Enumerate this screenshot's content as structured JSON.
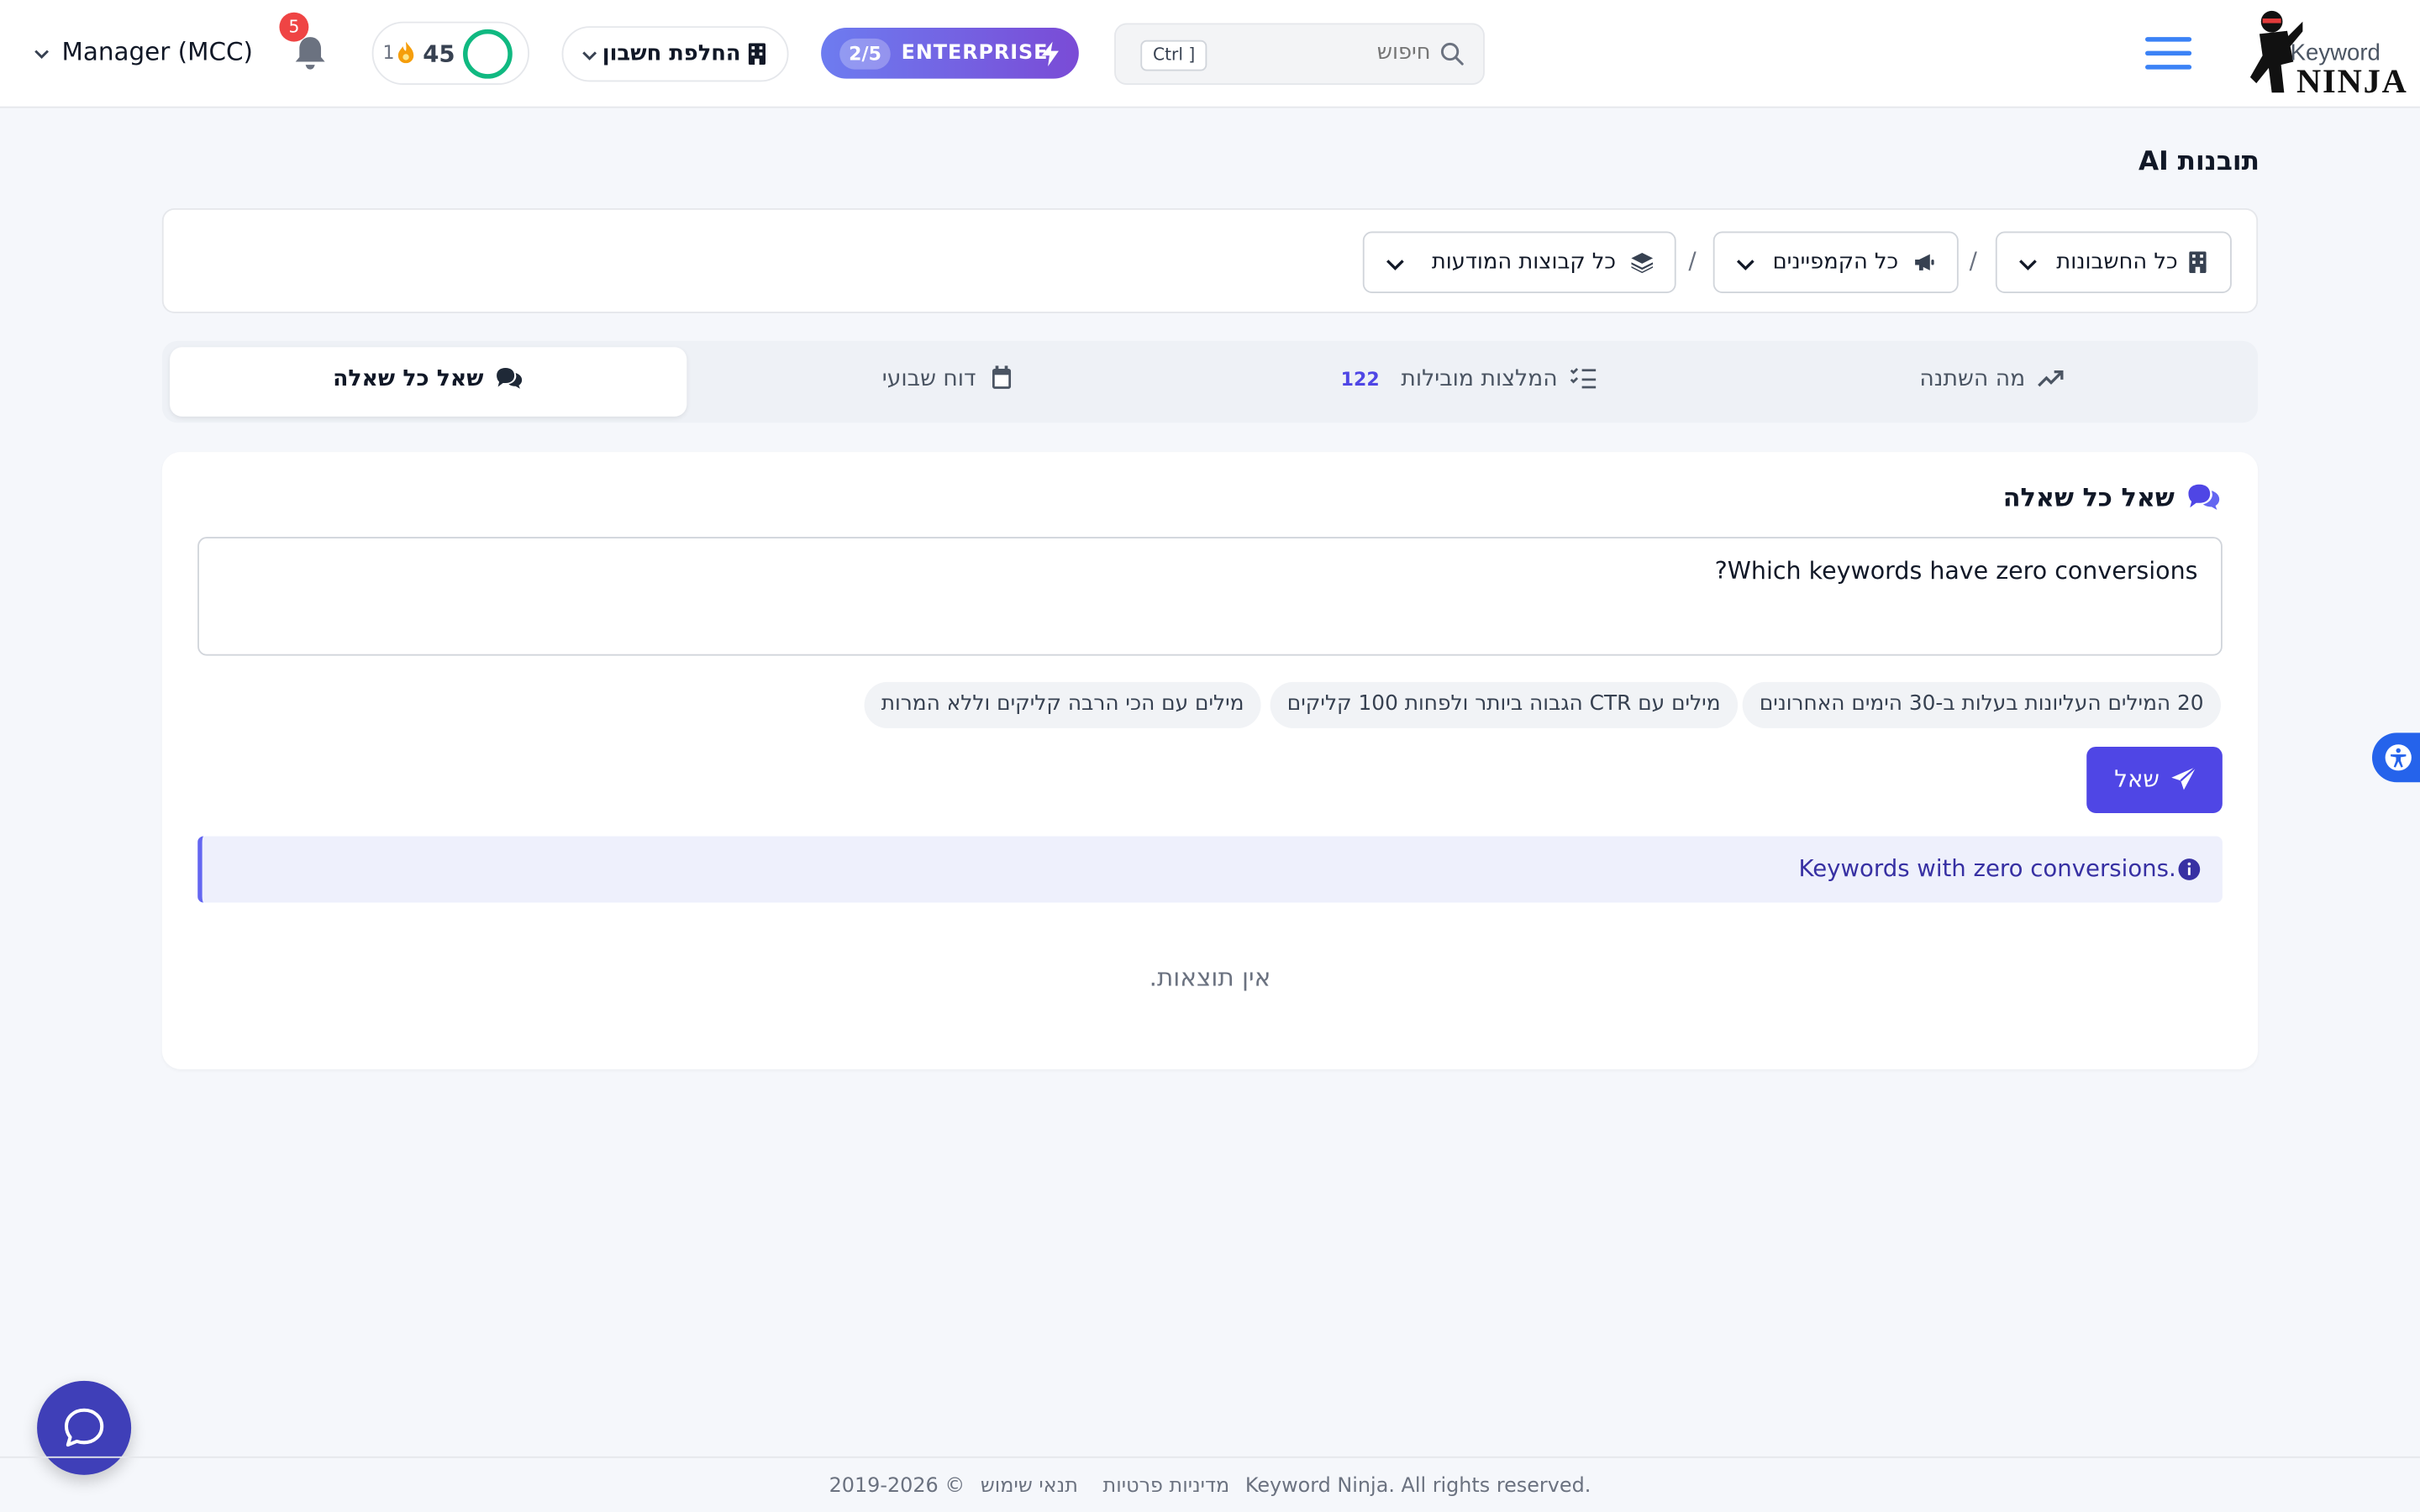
{
  "header": {
    "logo_top": "Keyword",
    "logo_bottom": "NINJA",
    "search_placeholder": "חיפוש",
    "search_shortcut": "Ctrl ]",
    "enterprise_label": "ENTERPRISE",
    "enterprise_count": "2/5",
    "switch_account_label": "החלפת חשבון",
    "score_value": "45",
    "streak_value": "1",
    "notifications_count": "5",
    "manager_label": "Manager (MCC)"
  },
  "page": {
    "title": "תובנות AI"
  },
  "filters": {
    "accounts_label": "כל החשבונות",
    "campaigns_label": "כל הקמפיינים",
    "adgroups_label": "כל קבוצות המודעות",
    "separator": "/"
  },
  "tabs": [
    {
      "label": "מה השתנה",
      "icon": "trend-up-icon"
    },
    {
      "label": "המלצות מובילות",
      "icon": "checklist-icon",
      "badge": "122"
    },
    {
      "label": "דוח שבועי",
      "icon": "calendar-icon"
    },
    {
      "label": "שאל כל שאלה",
      "icon": "comments-icon",
      "active": true
    }
  ],
  "ask": {
    "title": "שאל כל שאלה",
    "question_value": "Which keywords have zero conversions?",
    "suggestions": [
      "20 המילים העליונות בעלות ב-30 הימים האחרונים",
      "מילים עם CTR הגבוה ביותר ולפחות 100 קליקים",
      "מילים עם הכי הרבה קליקים וללא המרות"
    ],
    "ask_button_label": "שאל",
    "notice_text": "Keywords with zero conversions.",
    "empty_text": "אין תוצאות."
  },
  "footer": {
    "copyright": "© 2019-2026 Keyword Ninja. All rights reserved.",
    "terms": "תנאי שימוש",
    "privacy": "מדיניות פרטיות"
  },
  "colors": {
    "accent": "#4f46e5",
    "hamburger": "#3b82f6",
    "score_ring": "#10b981",
    "badge": "#ef4444"
  }
}
